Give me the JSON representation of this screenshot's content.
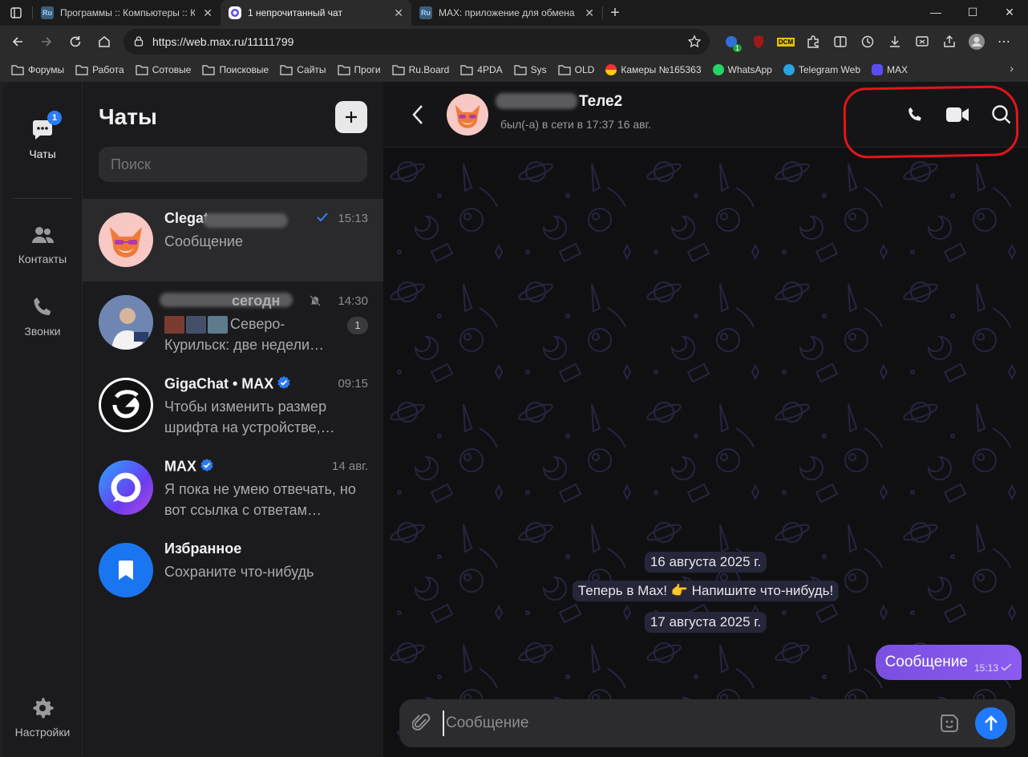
{
  "browser": {
    "tabs": [
      {
        "favicon": "Ru",
        "title": "Программы :: Компьютеры :: Ко",
        "active": false
      },
      {
        "favicon": "max-logo",
        "title": "1 непрочитанный чат",
        "active": true
      },
      {
        "favicon": "Ru",
        "title": "MAX: приложение для обмена с",
        "active": false
      }
    ],
    "url": "https://web.max.ru/11111799",
    "toolbar_badges": {
      "extension_count": "1",
      "dcm_label": "DCM"
    },
    "bookmarks": [
      {
        "label": "Форумы",
        "icon": "folder-icon"
      },
      {
        "label": "Работа",
        "icon": "folder-icon"
      },
      {
        "label": "Сотовые",
        "icon": "folder-icon"
      },
      {
        "label": "Поисковые",
        "icon": "folder-icon"
      },
      {
        "label": "Сайты",
        "icon": "folder-icon"
      },
      {
        "label": "Проги",
        "icon": "folder-icon"
      },
      {
        "label": "Ru.Board",
        "icon": "folder-icon"
      },
      {
        "label": "4PDA",
        "icon": "folder-icon"
      },
      {
        "label": "Sys",
        "icon": "folder-icon"
      },
      {
        "label": "OLD",
        "icon": "folder-icon"
      },
      {
        "label": "Камеры №165363",
        "icon": "camera-site-icon"
      },
      {
        "label": "WhatsApp",
        "icon": "whatsapp-icon"
      },
      {
        "label": "Telegram Web",
        "icon": "telegram-icon"
      },
      {
        "label": "MAX",
        "icon": "max-icon"
      }
    ]
  },
  "rail": {
    "chats": {
      "label": "Чаты",
      "badge": "1"
    },
    "contacts": {
      "label": "Контакты"
    },
    "calls": {
      "label": "Звонки"
    },
    "settings": {
      "label": "Настройки"
    }
  },
  "chatlist": {
    "title": "Чаты",
    "search_placeholder": "Поиск",
    "chats": [
      {
        "name": "Clegat",
        "time": "15:13",
        "message": "Сообщение",
        "read_check": true
      },
      {
        "name": "сегодн",
        "time": "14:30",
        "message": "Северо-Курильск: две недели…",
        "muted": true,
        "unread": "1"
      },
      {
        "name": "GigaChat • MAX",
        "time": "09:15",
        "message": "Чтобы изменить размер шрифта на устройстве,…",
        "verified": true
      },
      {
        "name": "MAX",
        "time": "14 авг.",
        "message": "Я пока не умею отвечать, но вот ссылка с ответам…",
        "verified": true
      },
      {
        "name": "Избранное",
        "time": "",
        "message": "Сохраните что-нибудь"
      }
    ]
  },
  "conversation": {
    "contact_name": "Теле2",
    "status": "был(-а) в сети в 17:37 16 авг.",
    "dates": [
      "16 августа 2025 г.",
      "17 августа 2025 г."
    ],
    "system_message": "Теперь в Max! 👉 Напишите что-нибудь!",
    "outgoing": {
      "text": "Сообщение",
      "time": "15:13"
    },
    "composer_placeholder": "Сообщение"
  },
  "colors": {
    "accent": "#1f7aff",
    "bubble": "#7a4fe0",
    "annotation": "#e3141a"
  }
}
